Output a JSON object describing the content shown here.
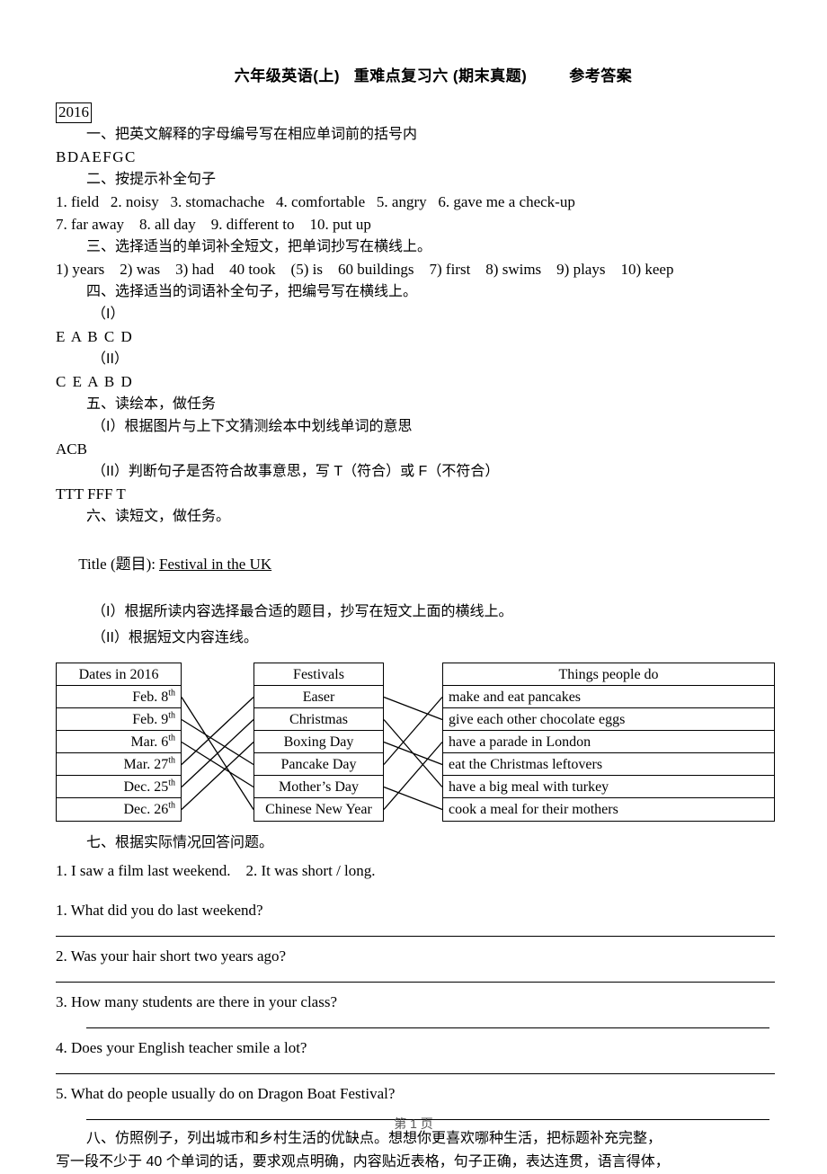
{
  "document": {
    "title": "六年级英语(上)   重难点复习六 (期末真题)         参考答案",
    "year_box": "2016",
    "footer": "第 1 页"
  },
  "sections": {
    "s1_heading": "一、把英文解释的字母编号写在相应单词前的括号内",
    "s1_answer": "BDAEFGC",
    "s2_heading": "二、按提示补全句子",
    "s2_answer_line1": "1. field   2. noisy   3. stomachache   4. comfortable   5. angry   6. gave me a check-up",
    "s2_answer_line2": "7. far away    8. all day    9. different to    10. put up",
    "s3_heading": "三、选择适当的单词补全短文，把单词抄写在横线上。",
    "s3_answer": "1) years    2) was    3) had    40 took    (5) is    60 buildings    7) first    8) swims    9) plays    10) keep",
    "s4_heading": "四、选择适当的词语补全句子，把编号写在横线上。",
    "s4_part1_label": "（I）",
    "s4_part1_answer": "E A B C D",
    "s4_part2_label": "（II）",
    "s4_part2_answer": "C E A B D",
    "s5_heading": "五、读绘本，做任务",
    "s5_part1_label": "（I）根据图片与上下文猜测绘本中划线单词的意思",
    "s5_part1_answer": "ACB",
    "s5_part2_label": "（II）判断句子是否符合故事意思，写 T（符合）或 F（不符合）",
    "s5_part2_answer": "TTT FFF T",
    "s6_heading": "六、读短文，做任务。",
    "s6_title_prefix": "Title (题目):",
    "s6_title_value": "Festival in the UK",
    "s6_part1_label": "（I）根据所读内容选择最合适的题目，抄写在短文上面的横线上。",
    "s6_part2_label": "（II）根据短文内容连线。",
    "s7_heading": "七、根据实际情况回答问题。",
    "s7_sample": "1. I saw a film last weekend.    2. It was short / long.",
    "s8_para_line1": "八、仿照例子，列出城市和乡村生活的优缺点。想想你更喜欢哪种生活，把标题补充完整，",
    "s8_para_line2": "写一段不少于 40 个单词的话，要求观点明确，内容贴近表格，句子正确，表达连贯，语言得体，"
  },
  "matching": {
    "dates_header": "Dates in 2016",
    "dates": [
      {
        "main": "Feb. 8",
        "sup": "th"
      },
      {
        "main": "Feb. 9",
        "sup": "th"
      },
      {
        "main": "Mar. 6",
        "sup": "th"
      },
      {
        "main": "Mar. 27",
        "sup": "th"
      },
      {
        "main": "Dec. 25",
        "sup": "th"
      },
      {
        "main": "Dec. 26",
        "sup": "th"
      }
    ],
    "festivals_header": "Festivals",
    "festivals": [
      "Easer",
      "Christmas",
      "Boxing Day",
      "Pancake Day",
      "Mother’s Day",
      "Chinese New Year"
    ],
    "things_header": "Things people do",
    "things": [
      "make and eat pancakes",
      "give each other chocolate eggs",
      "have a parade in London",
      "eat the Christmas leftovers",
      "have a big meal with turkey",
      "cook a meal for their mothers"
    ],
    "links_left": [
      {
        "from": 0,
        "to": 5
      },
      {
        "from": 1,
        "to": 3
      },
      {
        "from": 2,
        "to": 4
      },
      {
        "from": 3,
        "to": 0
      },
      {
        "from": 4,
        "to": 1
      },
      {
        "from": 5,
        "to": 2
      }
    ],
    "links_right": [
      {
        "from": 0,
        "to": 1
      },
      {
        "from": 1,
        "to": 4
      },
      {
        "from": 2,
        "to": 3
      },
      {
        "from": 3,
        "to": 0
      },
      {
        "from": 4,
        "to": 5
      },
      {
        "from": 5,
        "to": 2
      }
    ]
  },
  "questions": [
    "1. What did you do last weekend?",
    "2. Was your hair short two years ago?",
    "3. How many students are there in your class?",
    "4. Does your English teacher smile a lot?",
    "5. What do people usually do on Dragon Boat Festival?"
  ],
  "colors": {
    "ink": "#000000",
    "paper": "#ffffff",
    "footer_text": "#555555"
  }
}
